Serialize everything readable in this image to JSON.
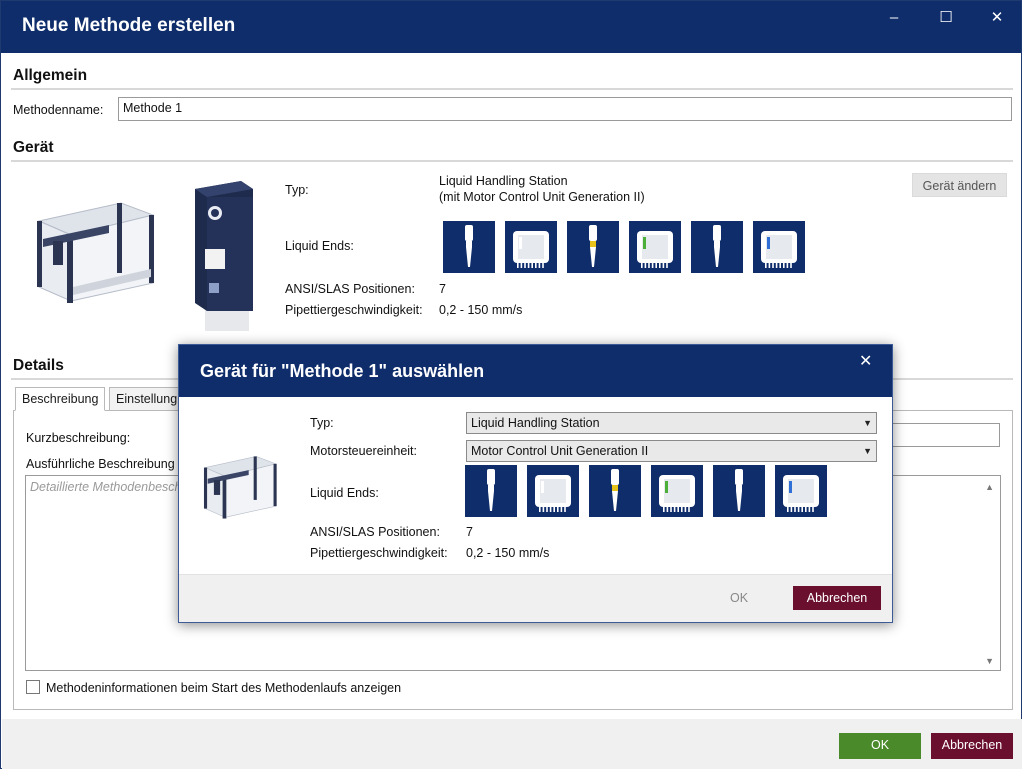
{
  "window": {
    "title": "Neue Methode erstellen",
    "minimize": "–",
    "maximize": "☐",
    "close": "✕"
  },
  "general": {
    "heading": "Allgemein",
    "method_name_label": "Methodenname:",
    "method_name_value": "Methode 1"
  },
  "device": {
    "heading": "Gerät",
    "type_label": "Typ:",
    "type_value_line1": "Liquid Handling Station",
    "type_value_line2": "(mit Motor Control Unit Generation II)",
    "change_button": "Gerät ändern",
    "liquid_ends_label": "Liquid Ends:",
    "ansi_label": "ANSI/SLAS Positionen:",
    "ansi_value": "7",
    "speed_label": "Pipettiergeschwindigkeit:",
    "speed_value": "0,2 - 150 mm/s",
    "liquid_ends": [
      {
        "kind": "single-pipette-icon",
        "accent": "#ffffff"
      },
      {
        "kind": "multi-channel-icon",
        "accent": "#ffffff"
      },
      {
        "kind": "single-pipette-icon",
        "accent": "#e6c21a"
      },
      {
        "kind": "multi-channel-icon",
        "accent": "#4caf3a"
      },
      {
        "kind": "single-pipette-icon",
        "accent": "#ffffff"
      },
      {
        "kind": "multi-channel-icon",
        "accent": "#2f6fd6"
      }
    ]
  },
  "details": {
    "heading": "Details",
    "tabs": [
      "Beschreibung",
      "Einstellung"
    ],
    "short_desc_label": "Kurzbeschreibung:",
    "long_desc_label": "Ausführliche Beschreibung",
    "long_desc_placeholder": "Detaillierte Methodenbesch",
    "show_info_checkbox_label": "Methodeninformationen beim Start des Methodenlaufs anzeigen",
    "show_info_checked": false
  },
  "footer": {
    "ok": "OK",
    "cancel": "Abbrechen"
  },
  "modal": {
    "title": "Gerät für \"Methode 1\" auswählen",
    "close": "✕",
    "type_label": "Typ:",
    "type_value": "Liquid Handling Station",
    "motor_label": "Motorsteuereinheit:",
    "motor_value": "Motor Control Unit Generation II",
    "liquid_ends_label": "Liquid Ends:",
    "ansi_label": "ANSI/SLAS Positionen:",
    "ansi_value": "7",
    "speed_label": "Pipettiergeschwindigkeit:",
    "speed_value": "0,2 - 150 mm/s",
    "ok": "OK",
    "cancel": "Abbrechen"
  },
  "colors": {
    "titlebar": "#0f2d6b",
    "ok_green": "#4a8a2a",
    "cancel_maroon": "#6b0f2f"
  }
}
